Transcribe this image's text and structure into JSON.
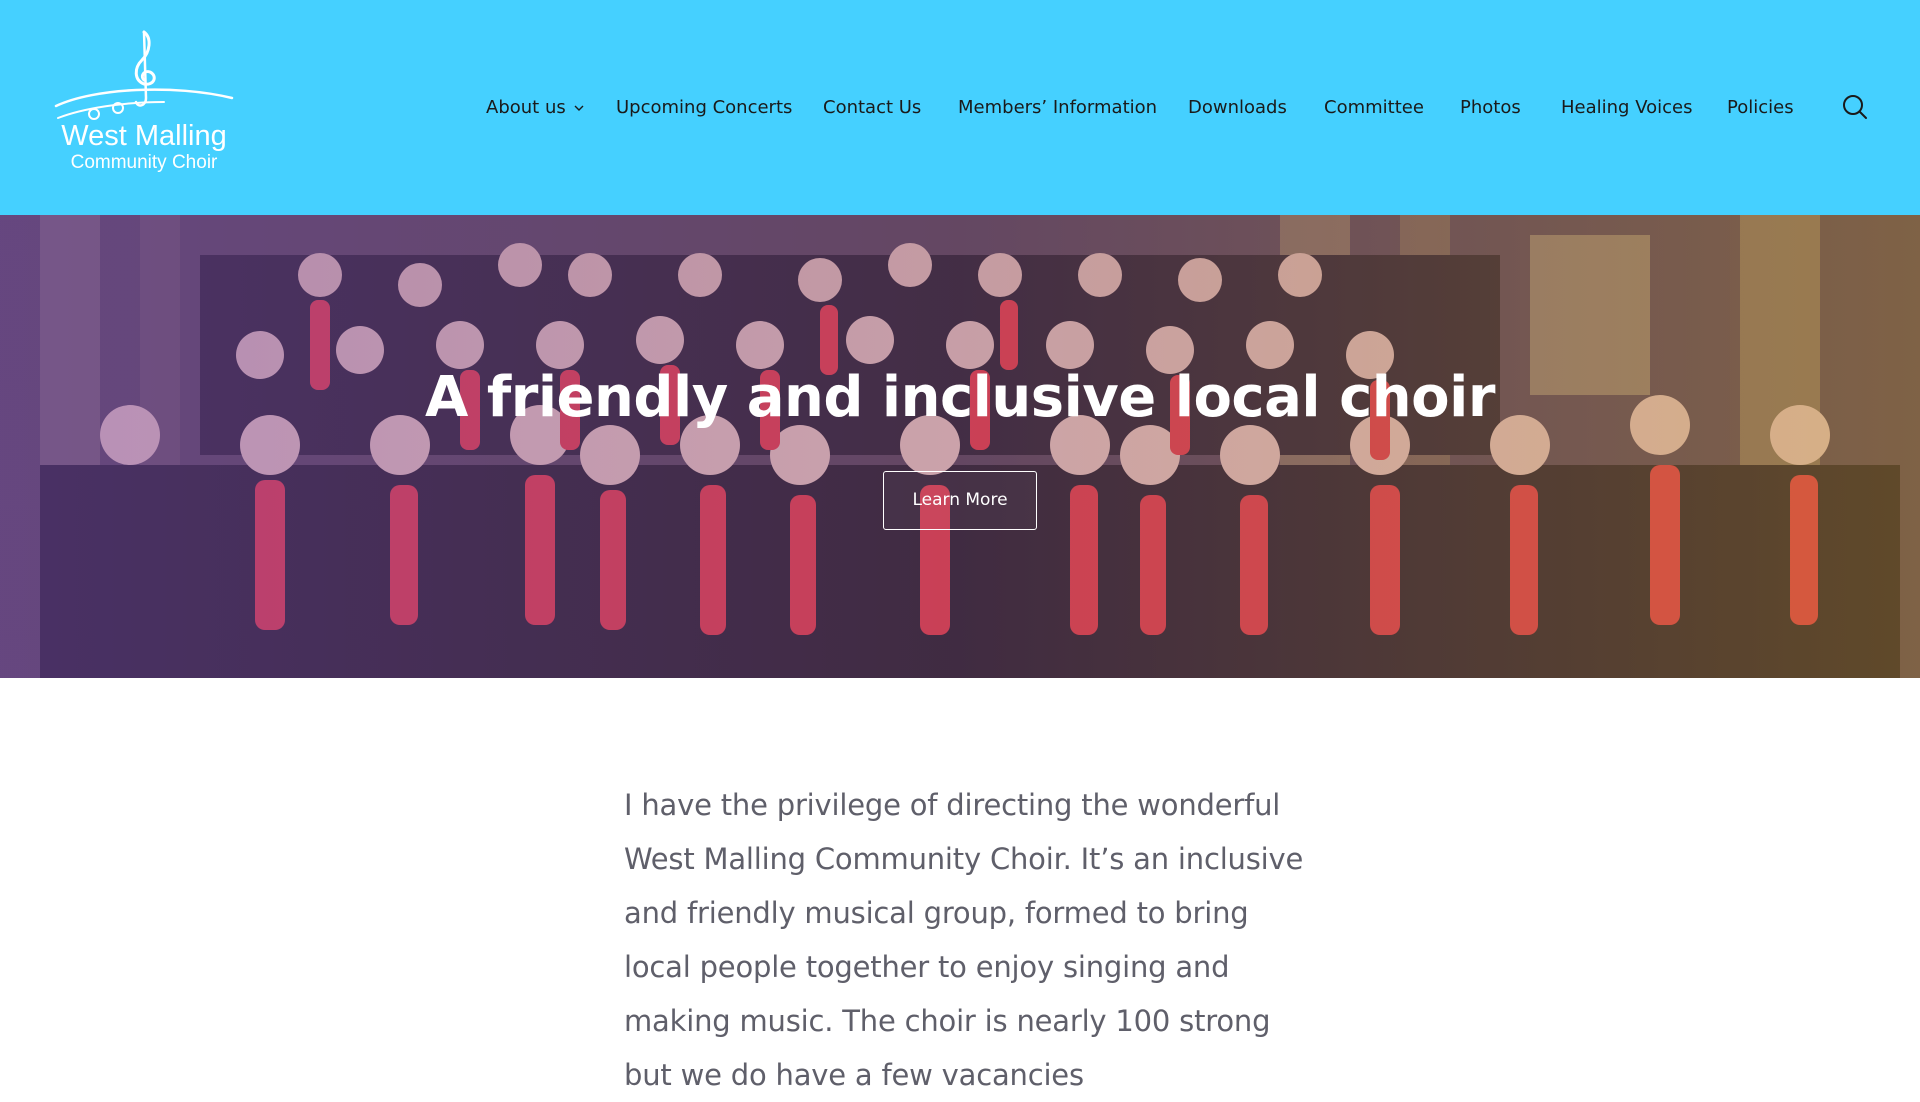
{
  "site": {
    "logo_line1": "West Malling",
    "logo_line2": "Community Choir",
    "logo_icon": "treble-clef-logo"
  },
  "nav": {
    "items": [
      {
        "label": "About us",
        "has_dropdown": true
      },
      {
        "label": "Upcoming Concerts"
      },
      {
        "label": "Contact Us"
      },
      {
        "label": "Members’ Information"
      },
      {
        "label": "Downloads"
      },
      {
        "label": "Committee"
      },
      {
        "label": "Photos"
      },
      {
        "label": "Healing Voices"
      },
      {
        "label": "Policies"
      }
    ],
    "search_icon": "search-icon"
  },
  "hero": {
    "title": "A friendly and inclusive local choir",
    "button_label": "Learn More"
  },
  "intro": {
    "text": "I have the privilege of directing the wonderful West Malling Community Choir. It’s an inclusive and friendly musical group, formed to bring local people together to enjoy singing and making music. The choir is nearly 100 strong but we do have a few vacancies"
  },
  "colors": {
    "header_bg": "#45d0ff",
    "nav_text": "#1a1a1a",
    "accent_scarf": "#e0343a",
    "body_text": "#5f5f6a"
  }
}
